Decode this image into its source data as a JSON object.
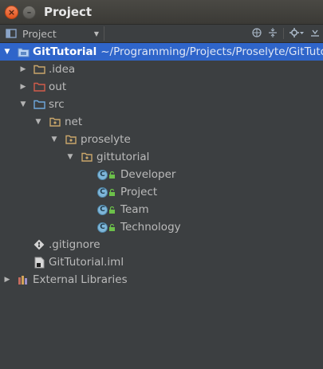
{
  "window": {
    "title": "Project",
    "close_glyph": "×",
    "min_glyph": "–"
  },
  "toolbar": {
    "view_label": "Project",
    "icons": [
      "globe-icon",
      "collapse-all-icon",
      "gear-icon",
      "hide-icon"
    ]
  },
  "colors": {
    "selection": "#2f65ca",
    "folder": "#c9a66b",
    "excluded_folder": "#d15c4a",
    "source_folder": "#6fa8dc",
    "class_icon": "#7eb6d9",
    "text": "#bbbbbb"
  },
  "tree": {
    "root": {
      "label": "GitTutorial",
      "path": "~/Programming/Projects/Proselyte/GitTutorial"
    },
    "idea": {
      "label": ".idea"
    },
    "out": {
      "label": "out"
    },
    "src": {
      "label": "src"
    },
    "net": {
      "label": "net"
    },
    "proselyte": {
      "label": "proselyte"
    },
    "gittutorial": {
      "label": "gittutorial"
    },
    "developer": {
      "label": "Developer",
      "icon_letter": "C"
    },
    "project": {
      "label": "Project",
      "icon_letter": "C"
    },
    "team": {
      "label": "Team",
      "icon_letter": "C"
    },
    "technology": {
      "label": "Technology",
      "icon_letter": "C"
    },
    "gitignore": {
      "label": ".gitignore"
    },
    "iml": {
      "label": "GitTutorial.iml"
    },
    "external": {
      "label": "External Libraries"
    }
  }
}
